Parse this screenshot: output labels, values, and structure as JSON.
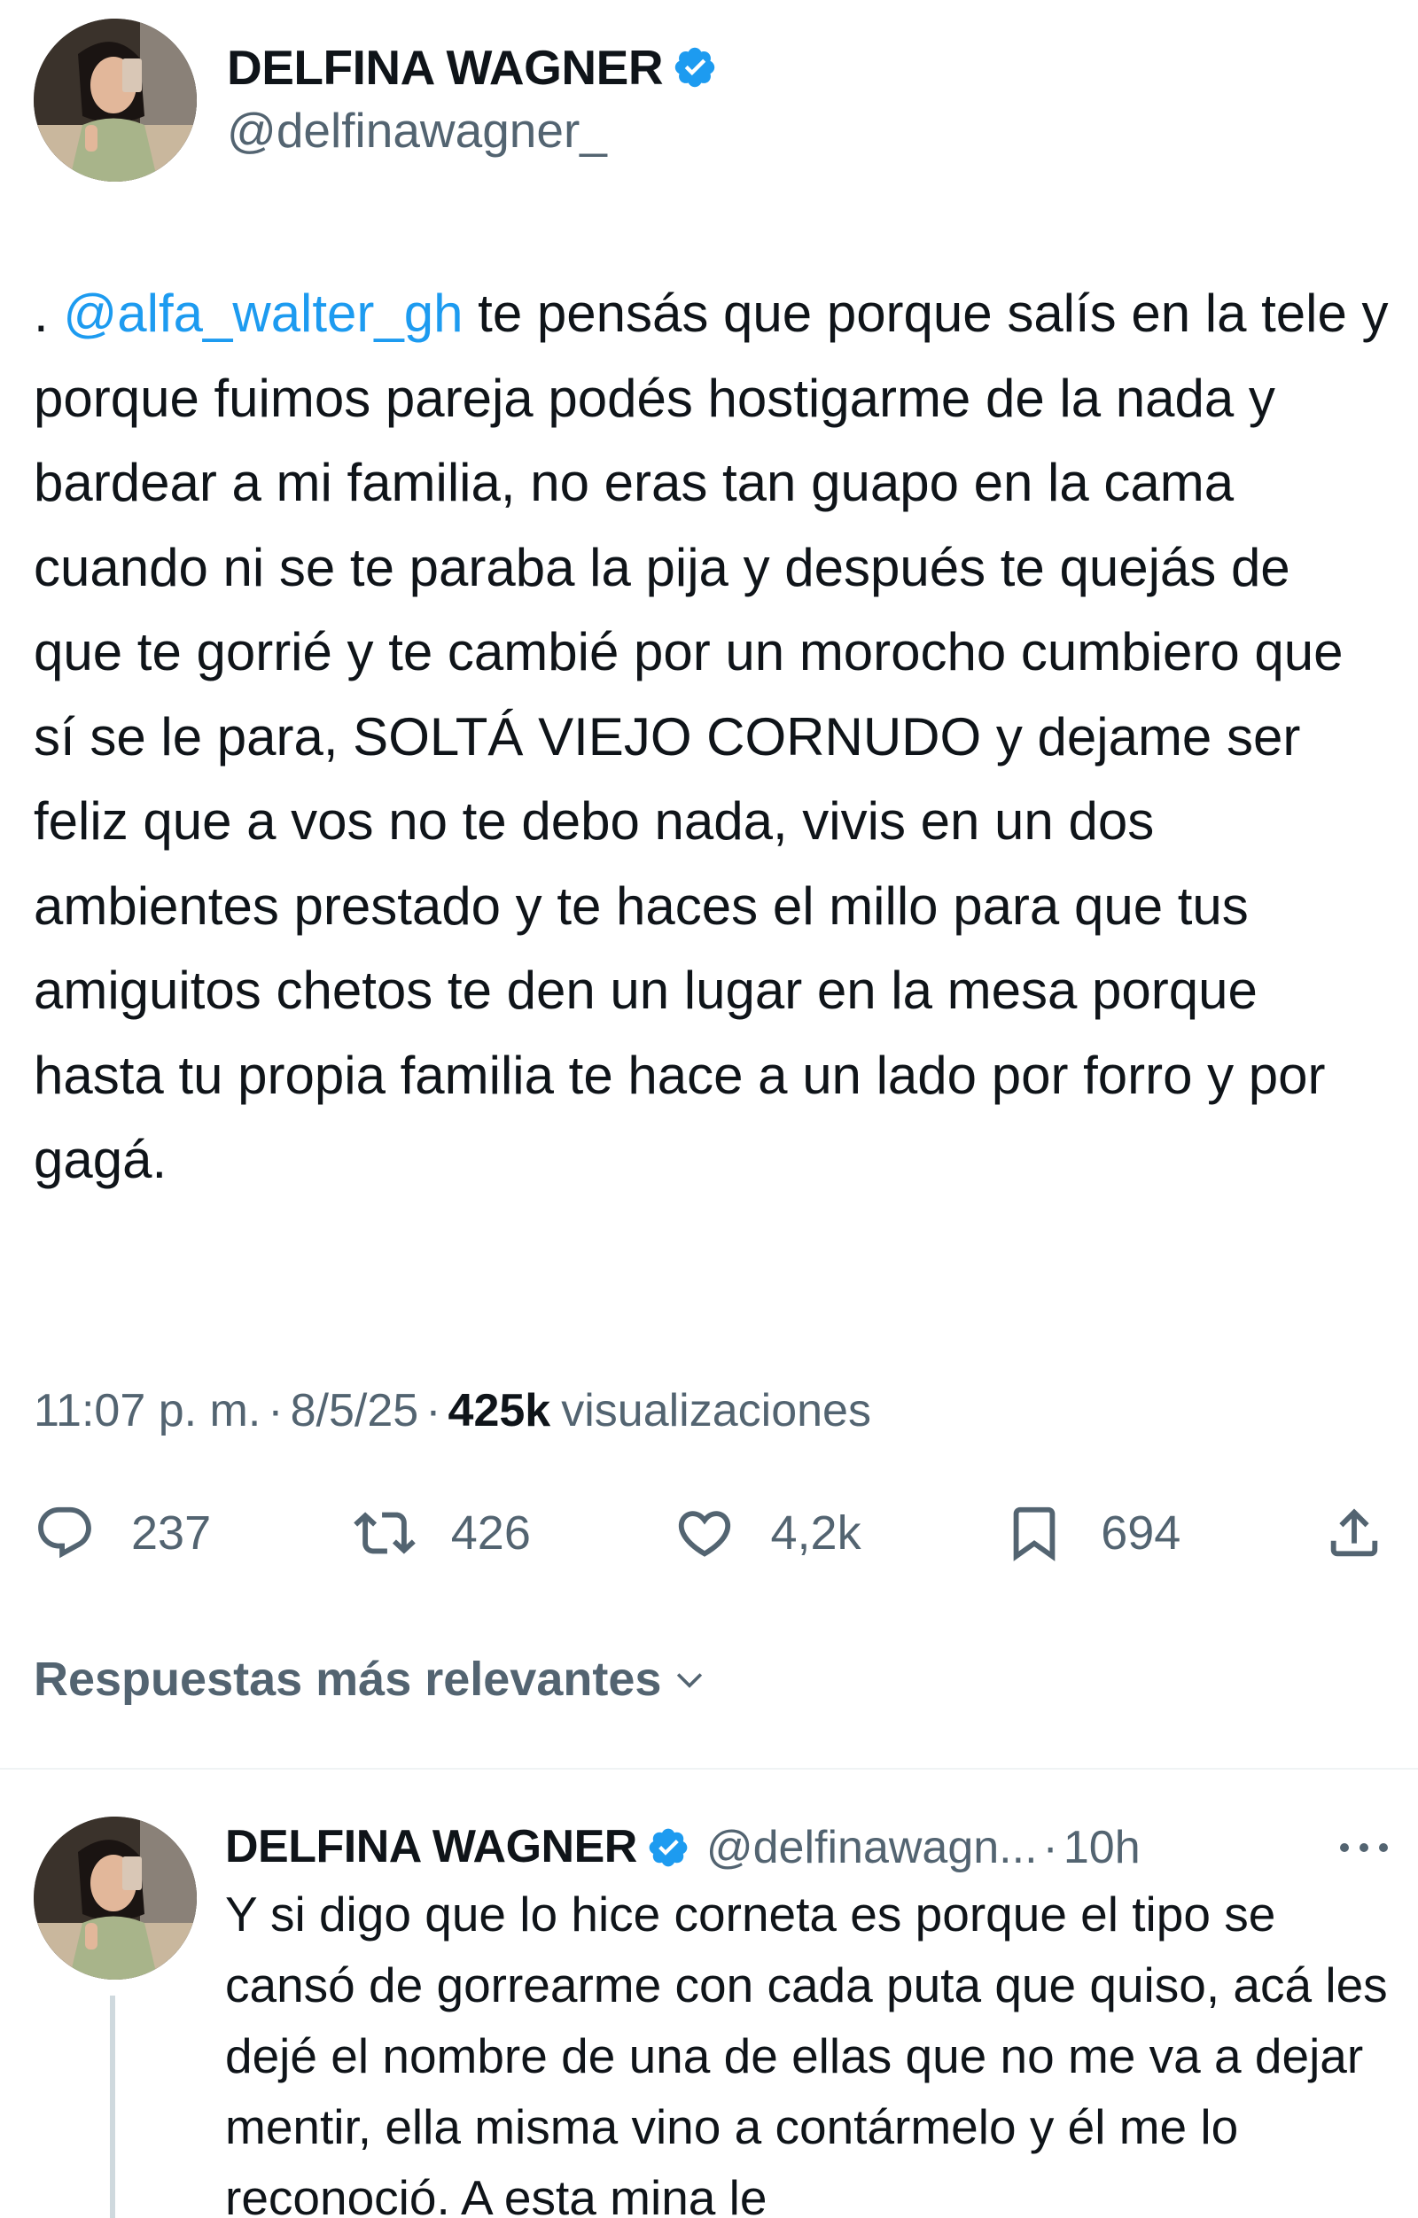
{
  "tweet": {
    "author": {
      "display_name": "DELFINA WAGNER",
      "handle": "@delfinawagner_",
      "avatar_icon": "user-avatar-photo",
      "verified_icon": "verified-badge-icon"
    },
    "text_prefix": ". ",
    "mention": "@alfa_walter_gh",
    "text_body": " te pensás que porque salís en la tele y porque fuimos pareja podés hostigarme de la nada y bardear a mi familia, no eras tan guapo en la cama cuando ni se te paraba la pija y después te quejás de que te gorrié y te cambié por un morocho cumbiero que sí se le para, SOLTÁ VIEJO CORNUDO y dejame ser feliz que a vos no te debo nada, vivis en un dos ambientes prestado y te haces el millo para que tus amiguitos chetos te den un lugar en la mesa porque hasta tu propia familia te hace a un lado por forro y por gagá.",
    "time": "11:07 p. m.",
    "separator": "·",
    "date": "8/5/25",
    "views_count": "425k",
    "views_label": "visualizaciones",
    "stats": {
      "replies": "237",
      "reposts": "426",
      "likes": "4,2k",
      "bookmarks": "694"
    }
  },
  "replies_sort": {
    "label": "Respuestas más relevantes",
    "icon": "chevron-down-icon"
  },
  "reply": {
    "display_name": "DELFINA WAGNER",
    "handle": "@delfinawagn...",
    "separator": "·",
    "time": "10h",
    "more_icon": "more-horizontal-icon",
    "text": "Y si digo que lo hice corneta es porque el tipo se cansó de gorrearme con cada puta que quiso, acá les dejé el nombre de una de ellas que no me va a dejar mentir, ella misma vino a contármelo y él me lo reconoció. A esta mina le"
  },
  "colors": {
    "text": "#0f1419",
    "secondary": "#536471",
    "accent": "#1d9bf0",
    "divider": "#eff3f4"
  }
}
